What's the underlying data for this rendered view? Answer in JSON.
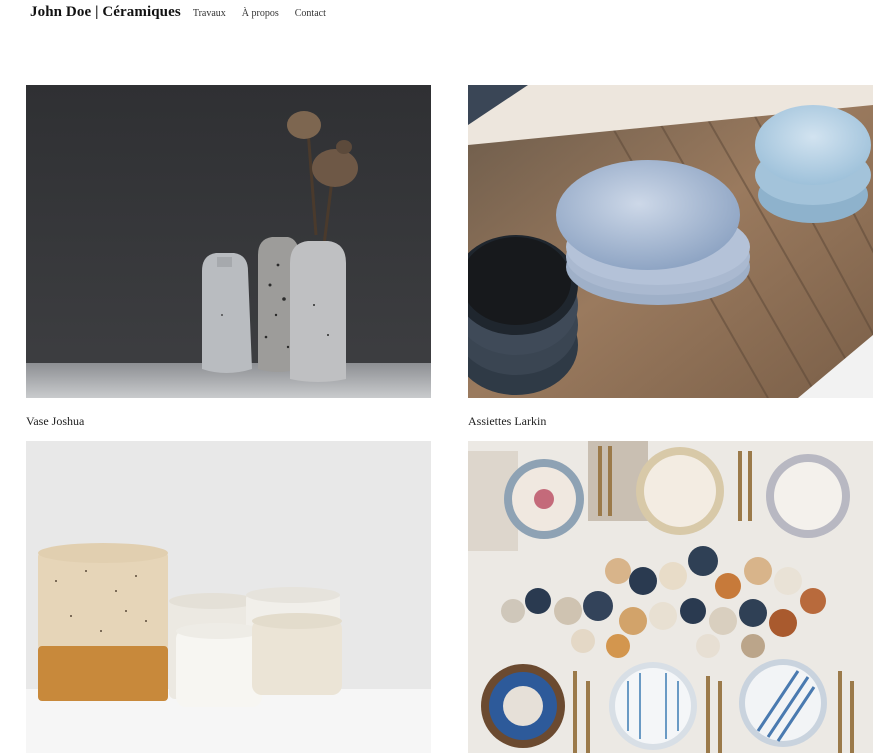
{
  "header": {
    "brand": "John Doe | Céramiques",
    "nav": [
      "Travaux",
      "À propos",
      "Contact"
    ]
  },
  "works": [
    {
      "title": "Vase Joshua"
    },
    {
      "title": "Assiettes Larkin"
    },
    {
      "title": ""
    },
    {
      "title": ""
    }
  ]
}
